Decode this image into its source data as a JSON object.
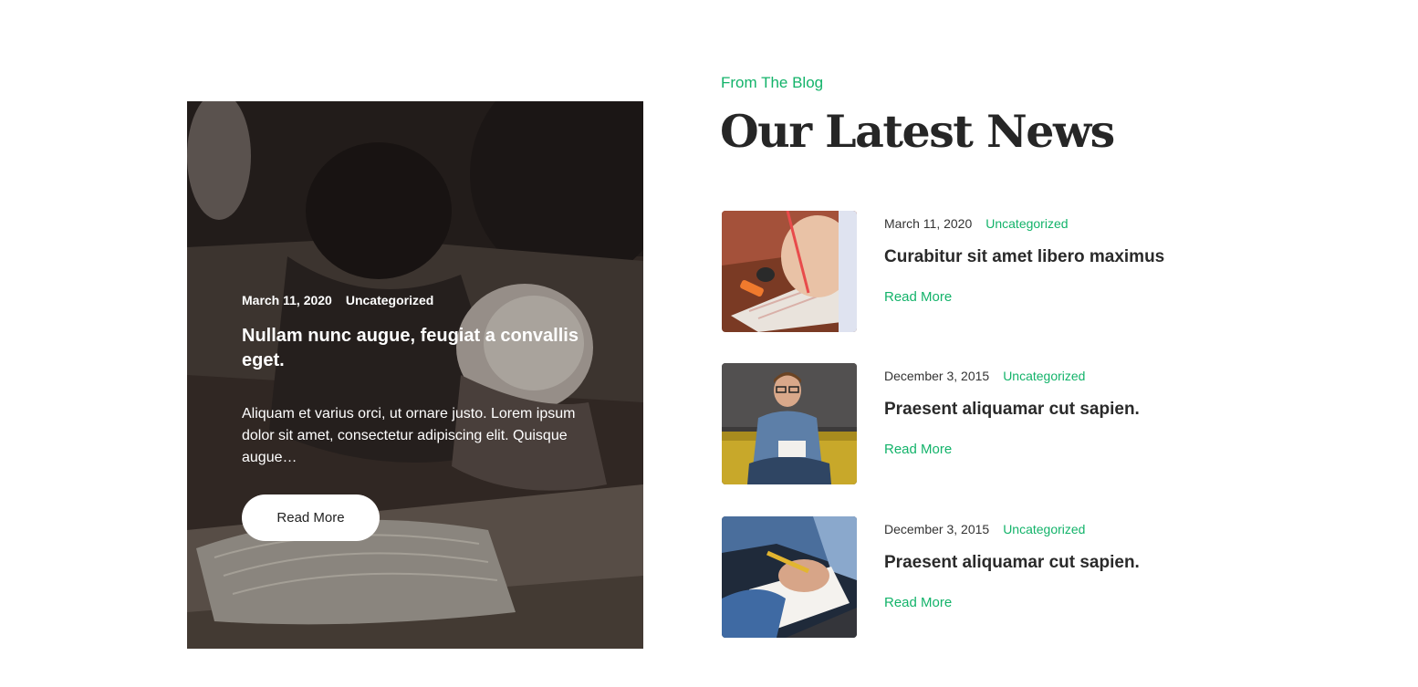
{
  "featured": {
    "date": "March 11, 2020",
    "category": "Uncategorized",
    "title": "Nullam nunc augue, feugiat a convallis eget.",
    "excerpt": "Aliquam et varius orci, ut ornare justo. Lorem ipsum dolor sit amet, consectetur adipiscing elit. Quisque augue…",
    "button_label": "Read More"
  },
  "section": {
    "eyebrow": "From The Blog",
    "heading": "Our Latest News"
  },
  "posts": [
    {
      "date": "March 11, 2020",
      "category": "Uncategorized",
      "title": "Curabitur sit amet libero maximus",
      "link_label": "Read More"
    },
    {
      "date": "December 3, 2015",
      "category": "Uncategorized",
      "title": "Praesent aliquamar cut sapien.",
      "link_label": "Read More"
    },
    {
      "date": "December 3, 2015",
      "category": "Uncategorized",
      "title": "Praesent aliquamar cut sapien.",
      "link_label": "Read More"
    }
  ],
  "colors": {
    "accent": "#13b36a",
    "heading": "#262626",
    "text": "#333333",
    "overlay": "#3a302c"
  }
}
